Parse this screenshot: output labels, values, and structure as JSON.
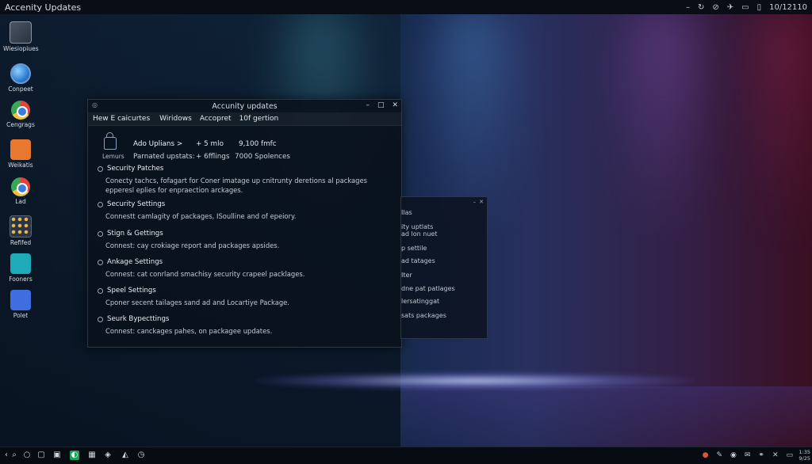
{
  "window_title": "Accenity Updates",
  "top_tray": {
    "icons": [
      "minus-icon",
      "refresh-icon",
      "compass-icon",
      "network-icon",
      "battery-icon",
      "bluetooth-icon"
    ],
    "clock": "10/12110"
  },
  "desktop_icons": [
    {
      "label": "Wiesiopiues",
      "icon": "monitor-icon"
    },
    {
      "label": "Conpeet",
      "icon": "globe-icon"
    },
    {
      "label": "Cengrags",
      "icon": "chrome-icon"
    },
    {
      "label": "Weikatis",
      "icon": "orange-app-icon"
    },
    {
      "label": "Lad",
      "icon": "chrome-icon"
    },
    {
      "label": "Refifed",
      "icon": "grid-app-icon"
    },
    {
      "label": "Fooners",
      "icon": "teal-app-icon"
    },
    {
      "label": "Polet",
      "icon": "blue-app-icon"
    }
  ],
  "main_window": {
    "title": "Accunity updates",
    "menu": [
      "Hew E caicurtes",
      "Wiridows",
      "Accopret",
      "10f gertion"
    ],
    "info": {
      "icon_label": "Lemurs",
      "row1": [
        "Ado Uplians >",
        "+ 5 mlo",
        "9,100 fmfc"
      ],
      "row2": [
        "Parnated upstats:",
        "+ 6fflings",
        "7000 Spolences"
      ]
    },
    "sections": [
      {
        "title": "Security Patches",
        "desc": [
          "Conecty tachcs, fofagart for Coner imatage up cnitrunty deretions al packages",
          "epperesl eplies for enpraection arckages."
        ]
      },
      {
        "title": "Security Settings",
        "desc": [
          "Connestt camlagity of packages, ISoulline and of epeiory."
        ]
      },
      {
        "title": "Stign & Gettings",
        "desc": [
          "Connest: cay crokiage report and packages apsides."
        ]
      },
      {
        "title": "Ankage Settings",
        "desc": [
          "Connest: cat conrland smachisy security crapeel packlages."
        ]
      },
      {
        "title": "Speel Settings",
        "desc": [
          "Cponer secent tailages sand ad and Locartiye Package."
        ]
      },
      {
        "title": "Seurk Bypecttings",
        "desc": [
          "Connest: canckages pahes, on packagee updates."
        ]
      }
    ]
  },
  "second_window": {
    "lines": [
      "Ilas",
      "ity uptlats",
      "ad lon nuet",
      "p settile",
      "ad tatages",
      "Iter",
      "dne pat patlages",
      "lersatinggat",
      "sats packages"
    ]
  },
  "taskbar": {
    "icons": [
      "back-icon",
      "search-icon",
      "circle-icon",
      "task-view-icon",
      "window-icon",
      "edge-icon",
      "store-icon",
      "app-icon",
      "photo-icon",
      "clock-icon"
    ],
    "tray_icons": [
      "alert-icon",
      "pen-icon",
      "shield-icon",
      "mail-icon",
      "link-icon",
      "mute-icon",
      "monitor-icon"
    ],
    "clock": "1:35",
    "date": "9/25"
  }
}
